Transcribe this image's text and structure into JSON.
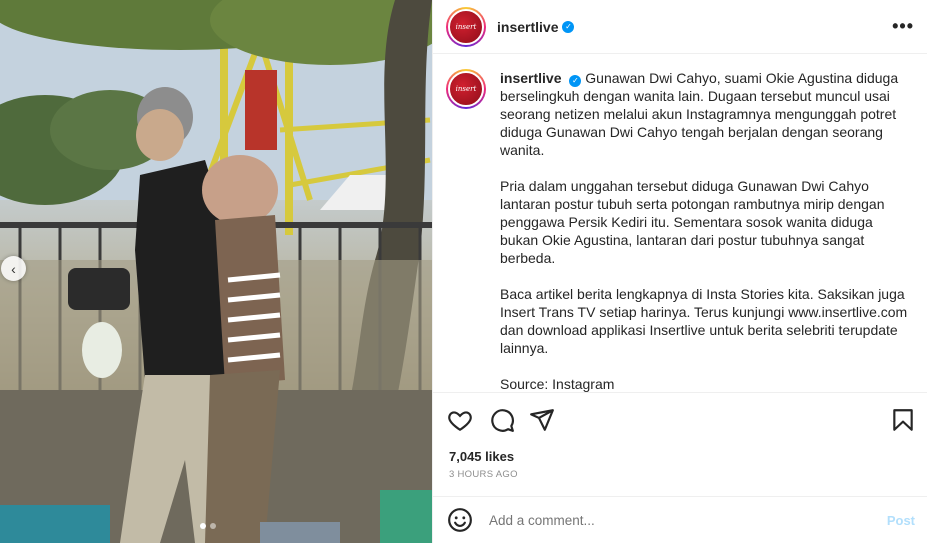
{
  "post": {
    "username": "insertlive",
    "verified_icon": "verified-badge-icon",
    "avatar_text": "insertlive",
    "more_icon": "more-options-icon"
  },
  "caption": {
    "username": "insertlive",
    "paragraphs": [
      "Gunawan Dwi Cahyo, suami Okie Agustina diduga berselingkuh dengan wanita lain. Dugaan tersebut muncul usai seorang netizen melalui akun Instagramnya mengunggah potret diduga Gunawan Dwi Cahyo tengah berjalan dengan seorang wanita.",
      "Pria dalam unggahan tersebut diduga Gunawan Dwi Cahyo lantaran postur tubuh serta potongan rambutnya mirip dengan penggawa Persik Kediri itu. Sementara sosok wanita diduga bukan Okie Agustina, lantaran dari postur tubuhnya sangat berbeda.",
      "Baca artikel berita lengkapnya di Insta Stories kita. Saksikan juga Insert Trans TV setiap harinya. Terus kunjungi www.insertlive.com dan download applikasi Insertlive untuk berita selebriti terupdate lainnya.",
      "Source: Instagram"
    ]
  },
  "engagement": {
    "likes": "7,045 likes",
    "time": "3 HOURS AGO"
  },
  "comment": {
    "placeholder": "Add a comment...",
    "post_label": "Post"
  },
  "carousel": {
    "total": 2,
    "active": 1
  },
  "colors": {
    "accent": "#0095f6",
    "post_disabled": "#b2dffc",
    "border": "#efefef"
  }
}
